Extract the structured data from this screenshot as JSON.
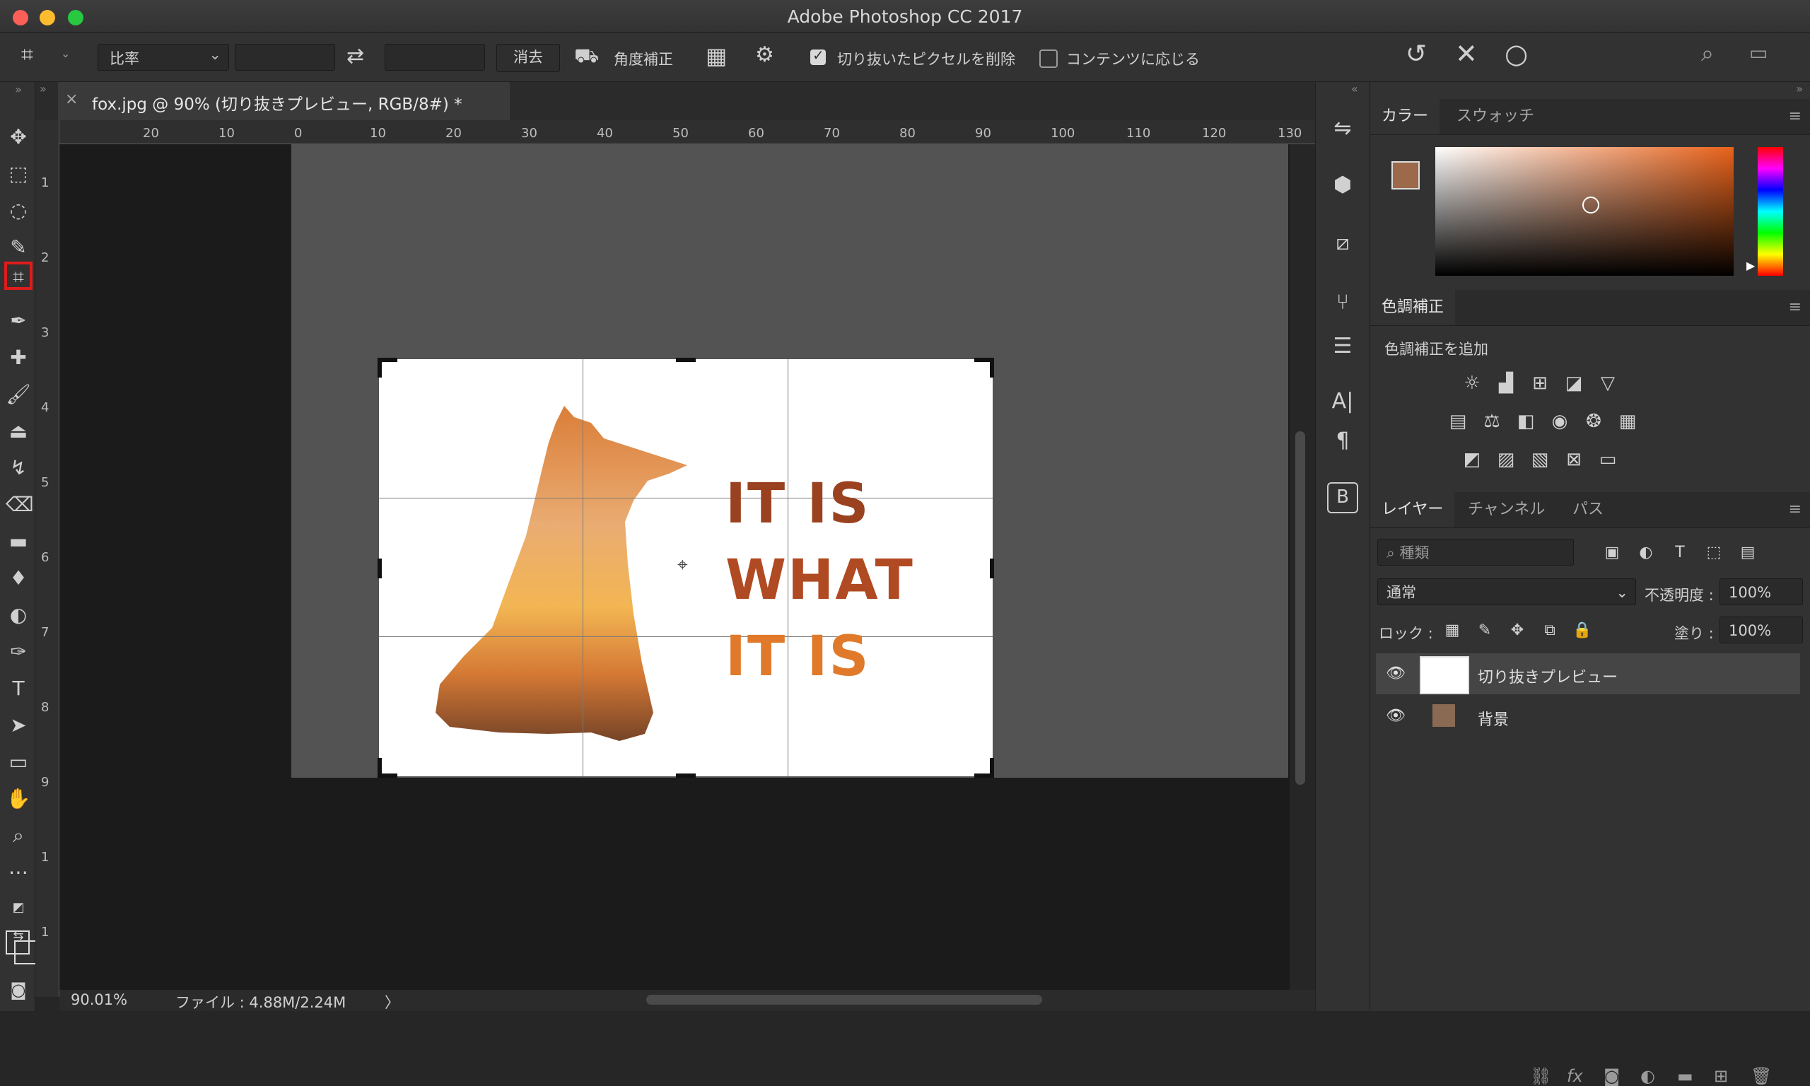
{
  "window": {
    "title": "Adobe Photoshop CC 2017"
  },
  "options_bar": {
    "ratio_preset": "比率",
    "swap_icon": "swap-arrows-icon",
    "clear_label": "消去",
    "straighten_label": "角度補正",
    "delete_pixels_label": "切り抜いたピクセルを削除",
    "delete_pixels_checked": true,
    "content_aware_label": "コンテンツに応じる",
    "content_aware_checked": false
  },
  "document": {
    "tab_title": "fox.jpg @ 90% (切り抜きプレビュー, RGB/8#) *",
    "close_glyph": "×",
    "ruler_h": [
      "20",
      "10",
      "0",
      "10",
      "20",
      "30",
      "40",
      "50",
      "60",
      "70",
      "80",
      "90",
      "100",
      "110",
      "120",
      "130"
    ],
    "ruler_v": [
      "1",
      "2",
      "3",
      "4",
      "5",
      "6",
      "7",
      "8",
      "9",
      "1",
      "1"
    ],
    "canvas_text": [
      "IT IS",
      "WHAT",
      "IT IS"
    ]
  },
  "status": {
    "zoom": "90.01%",
    "file_info": "ファイル : 4.88M/2.24M",
    "arrow": "〉"
  },
  "panels": {
    "color": {
      "tabs": [
        "カラー",
        "スウォッチ"
      ],
      "foreground": "#9c6a4b",
      "background": "#8a6a52"
    },
    "adjustments": {
      "title": "色調補正",
      "subtitle": "色調補正を追加"
    },
    "layers": {
      "tabs": [
        "レイヤー",
        "チャンネル",
        "パス"
      ],
      "filter_placeholder": "種類",
      "blend_mode": "通常",
      "opacity_label": "不透明度 :",
      "opacity_value": "100%",
      "lock_label": "ロック :",
      "fill_label": "塗り :",
      "fill_value": "100%",
      "items": [
        {
          "name": "切り抜きプレビュー",
          "selected": true
        },
        {
          "name": "背景",
          "selected": false
        }
      ]
    }
  },
  "colors": {
    "accent_highlight": "#e01b1b",
    "text_orange": "#c85a28",
    "text_brown": "#8c3a1f"
  }
}
